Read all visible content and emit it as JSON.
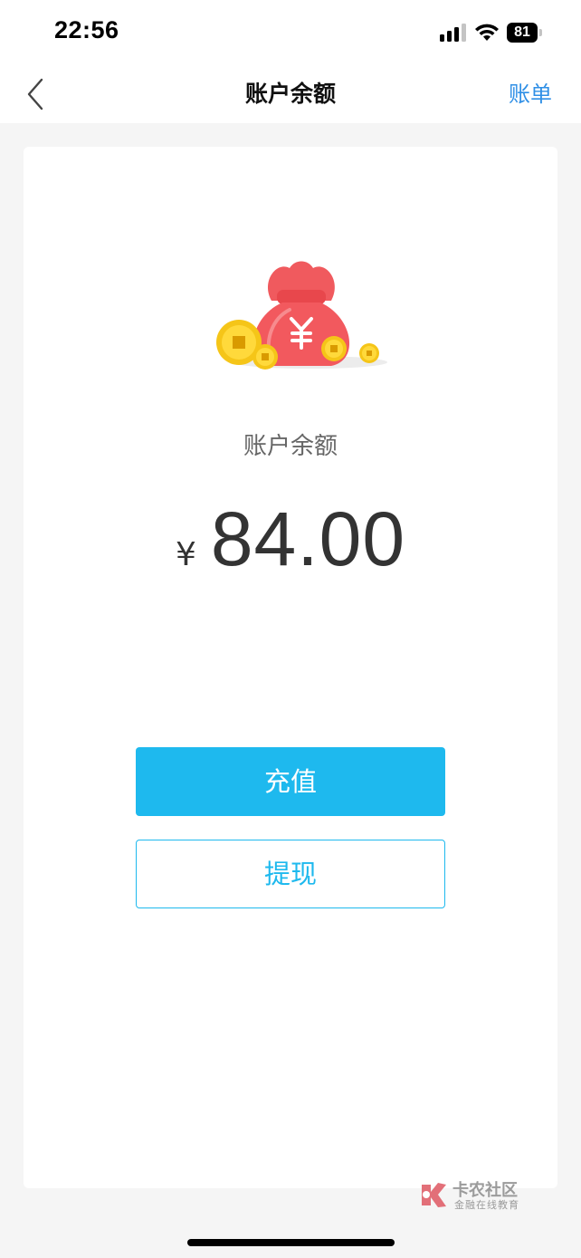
{
  "status_bar": {
    "time": "22:56",
    "battery_level": "81",
    "signal_icon": "cellular-signal-icon",
    "wifi_icon": "wifi-icon"
  },
  "navbar": {
    "back_icon": "chevron-left-icon",
    "title": "账户余额",
    "right_label": "账单"
  },
  "balance": {
    "illustration": "money-bag-coins-illustration",
    "label": "账户余额",
    "currency_symbol": "¥",
    "amount": "84.00"
  },
  "actions": {
    "recharge_label": "充值",
    "withdraw_label": "提现"
  },
  "watermark": {
    "title": "卡农社区",
    "subtitle": "金融在线教育"
  },
  "colors": {
    "primary": "#1eb9ee",
    "link": "#2f8fe6",
    "background": "#f5f5f5",
    "card": "#ffffff",
    "bag": "#f2595e",
    "coin": "#f5c518"
  }
}
